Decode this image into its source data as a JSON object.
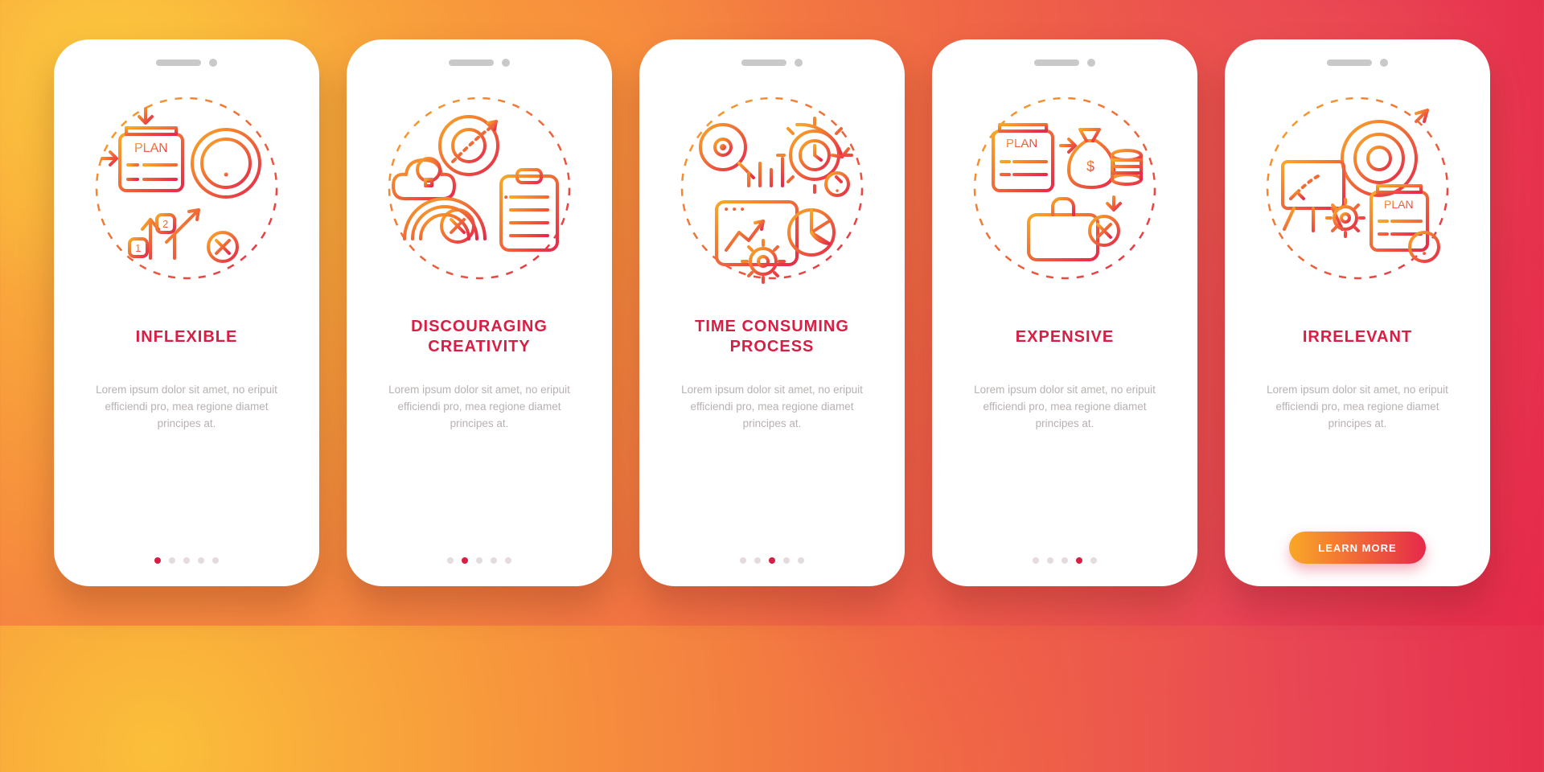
{
  "screens": [
    {
      "title": "INFLEXIBLE",
      "desc": "Lorem ipsum dolor sit amet, no eripuit efficiendi pro, mea regione diamet principes at.",
      "dots_total": 5,
      "active_dot": 0,
      "has_cta": false
    },
    {
      "title": "DISCOURAGING\nCREATIVITY",
      "desc": "Lorem ipsum dolor sit amet, no eripuit efficiendi pro, mea regione diamet principes at.",
      "dots_total": 5,
      "active_dot": 1,
      "has_cta": false
    },
    {
      "title": "TIME CONSUMING\nPROCESS",
      "desc": "Lorem ipsum dolor sit amet, no eripuit efficiendi pro, mea regione diamet principes at.",
      "dots_total": 5,
      "active_dot": 2,
      "has_cta": false
    },
    {
      "title": "EXPENSIVE",
      "desc": "Lorem ipsum dolor sit amet, no eripuit efficiendi pro, mea regione diamet principes at.",
      "dots_total": 5,
      "active_dot": 3,
      "has_cta": false
    },
    {
      "title": "IRRELEVANT",
      "desc": "Lorem ipsum dolor sit amet, no eripuit efficiendi pro, mea regione diamet principes at.",
      "dots_total": 5,
      "active_dot": 4,
      "has_cta": true
    }
  ],
  "cta_label": "LEARN MORE",
  "colors": {
    "gradient_start": "#f9a826",
    "gradient_end": "#e6294a",
    "headline": "#d81e44"
  },
  "icon_labels": {
    "0": "plan-warning-icon",
    "1": "creativity-block-icon",
    "2": "time-process-icon",
    "3": "money-plan-icon",
    "4": "target-miss-icon"
  }
}
